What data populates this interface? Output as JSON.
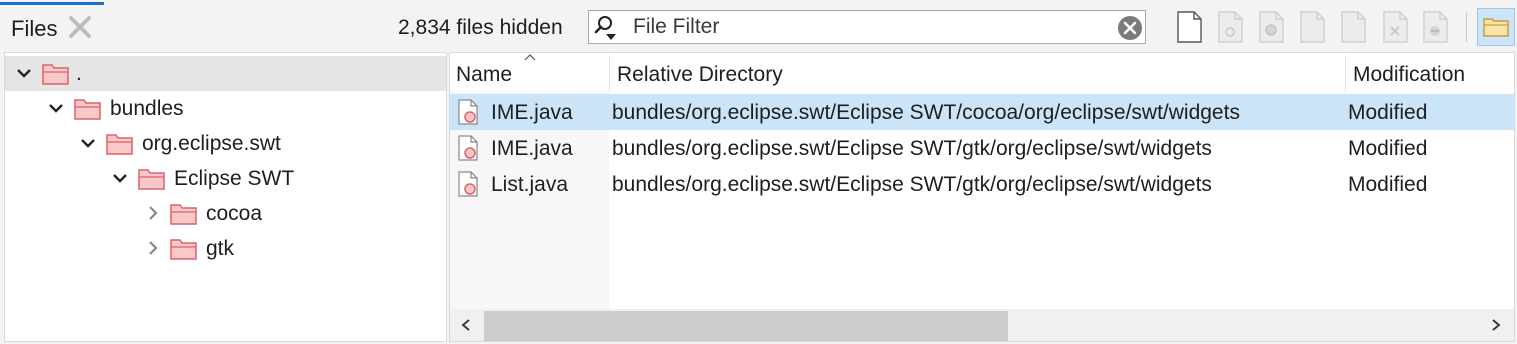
{
  "tab": {
    "title": "Files"
  },
  "toolbar": {
    "hidden_count": "2,834 files hidden",
    "filter": {
      "placeholder": "File Filter",
      "value": ""
    },
    "icons": [
      "new-file-icon",
      "file-settings-icon",
      "file-record-icon",
      "file-icon",
      "file-icon",
      "file-remove-icon",
      "file-minus-icon",
      "folder-icon"
    ]
  },
  "tree": [
    {
      "label": ".",
      "expanded": true,
      "selected": true
    },
    {
      "label": "bundles",
      "expanded": true
    },
    {
      "label": "org.eclipse.swt",
      "expanded": true
    },
    {
      "label": "Eclipse SWT",
      "expanded": true
    },
    {
      "label": "cocoa",
      "expanded": false
    },
    {
      "label": "gtk",
      "expanded": false
    }
  ],
  "table": {
    "columns": [
      "Name",
      "Relative Directory",
      "Modification"
    ],
    "rows": [
      {
        "name": "IME.java",
        "directory": "bundles/org.eclipse.swt/Eclipse SWT/cocoa/org/eclipse/swt/widgets",
        "modification": "Modified",
        "selected": true
      },
      {
        "name": "IME.java",
        "directory": "bundles/org.eclipse.swt/Eclipse SWT/gtk/org/eclipse/swt/widgets",
        "modification": "Modified"
      },
      {
        "name": "List.java",
        "directory": "bundles/org.eclipse.swt/Eclipse SWT/gtk/org/eclipse/swt/widgets",
        "modification": "Modified"
      }
    ]
  },
  "colors": {
    "accent": "#1e6fd0",
    "selection": "#cce4f7",
    "folder_fill": "#f9c9c9",
    "folder_stroke": "#d9636b"
  }
}
